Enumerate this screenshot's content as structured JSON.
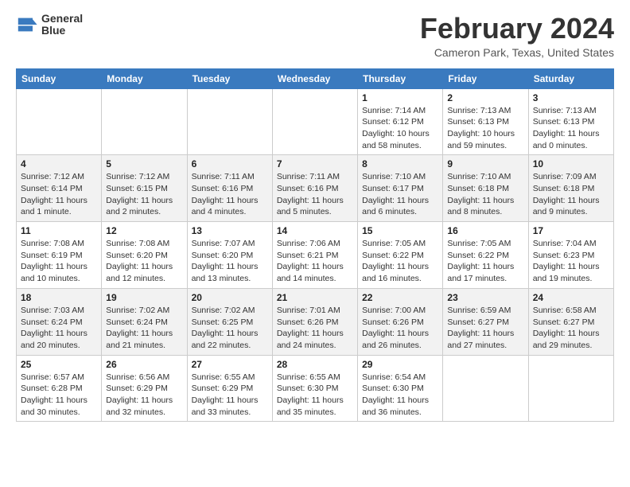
{
  "header": {
    "logo_line1": "General",
    "logo_line2": "Blue",
    "month_title": "February 2024",
    "location": "Cameron Park, Texas, United States"
  },
  "weekdays": [
    "Sunday",
    "Monday",
    "Tuesday",
    "Wednesday",
    "Thursday",
    "Friday",
    "Saturday"
  ],
  "weeks": [
    [
      {
        "day": "",
        "info": ""
      },
      {
        "day": "",
        "info": ""
      },
      {
        "day": "",
        "info": ""
      },
      {
        "day": "",
        "info": ""
      },
      {
        "day": "1",
        "info": "Sunrise: 7:14 AM\nSunset: 6:12 PM\nDaylight: 10 hours\nand 58 minutes."
      },
      {
        "day": "2",
        "info": "Sunrise: 7:13 AM\nSunset: 6:13 PM\nDaylight: 10 hours\nand 59 minutes."
      },
      {
        "day": "3",
        "info": "Sunrise: 7:13 AM\nSunset: 6:13 PM\nDaylight: 11 hours\nand 0 minutes."
      }
    ],
    [
      {
        "day": "4",
        "info": "Sunrise: 7:12 AM\nSunset: 6:14 PM\nDaylight: 11 hours\nand 1 minute."
      },
      {
        "day": "5",
        "info": "Sunrise: 7:12 AM\nSunset: 6:15 PM\nDaylight: 11 hours\nand 2 minutes."
      },
      {
        "day": "6",
        "info": "Sunrise: 7:11 AM\nSunset: 6:16 PM\nDaylight: 11 hours\nand 4 minutes."
      },
      {
        "day": "7",
        "info": "Sunrise: 7:11 AM\nSunset: 6:16 PM\nDaylight: 11 hours\nand 5 minutes."
      },
      {
        "day": "8",
        "info": "Sunrise: 7:10 AM\nSunset: 6:17 PM\nDaylight: 11 hours\nand 6 minutes."
      },
      {
        "day": "9",
        "info": "Sunrise: 7:10 AM\nSunset: 6:18 PM\nDaylight: 11 hours\nand 8 minutes."
      },
      {
        "day": "10",
        "info": "Sunrise: 7:09 AM\nSunset: 6:18 PM\nDaylight: 11 hours\nand 9 minutes."
      }
    ],
    [
      {
        "day": "11",
        "info": "Sunrise: 7:08 AM\nSunset: 6:19 PM\nDaylight: 11 hours\nand 10 minutes."
      },
      {
        "day": "12",
        "info": "Sunrise: 7:08 AM\nSunset: 6:20 PM\nDaylight: 11 hours\nand 12 minutes."
      },
      {
        "day": "13",
        "info": "Sunrise: 7:07 AM\nSunset: 6:20 PM\nDaylight: 11 hours\nand 13 minutes."
      },
      {
        "day": "14",
        "info": "Sunrise: 7:06 AM\nSunset: 6:21 PM\nDaylight: 11 hours\nand 14 minutes."
      },
      {
        "day": "15",
        "info": "Sunrise: 7:05 AM\nSunset: 6:22 PM\nDaylight: 11 hours\nand 16 minutes."
      },
      {
        "day": "16",
        "info": "Sunrise: 7:05 AM\nSunset: 6:22 PM\nDaylight: 11 hours\nand 17 minutes."
      },
      {
        "day": "17",
        "info": "Sunrise: 7:04 AM\nSunset: 6:23 PM\nDaylight: 11 hours\nand 19 minutes."
      }
    ],
    [
      {
        "day": "18",
        "info": "Sunrise: 7:03 AM\nSunset: 6:24 PM\nDaylight: 11 hours\nand 20 minutes."
      },
      {
        "day": "19",
        "info": "Sunrise: 7:02 AM\nSunset: 6:24 PM\nDaylight: 11 hours\nand 21 minutes."
      },
      {
        "day": "20",
        "info": "Sunrise: 7:02 AM\nSunset: 6:25 PM\nDaylight: 11 hours\nand 22 minutes."
      },
      {
        "day": "21",
        "info": "Sunrise: 7:01 AM\nSunset: 6:26 PM\nDaylight: 11 hours\nand 24 minutes."
      },
      {
        "day": "22",
        "info": "Sunrise: 7:00 AM\nSunset: 6:26 PM\nDaylight: 11 hours\nand 26 minutes."
      },
      {
        "day": "23",
        "info": "Sunrise: 6:59 AM\nSunset: 6:27 PM\nDaylight: 11 hours\nand 27 minutes."
      },
      {
        "day": "24",
        "info": "Sunrise: 6:58 AM\nSunset: 6:27 PM\nDaylight: 11 hours\nand 29 minutes."
      }
    ],
    [
      {
        "day": "25",
        "info": "Sunrise: 6:57 AM\nSunset: 6:28 PM\nDaylight: 11 hours\nand 30 minutes."
      },
      {
        "day": "26",
        "info": "Sunrise: 6:56 AM\nSunset: 6:29 PM\nDaylight: 11 hours\nand 32 minutes."
      },
      {
        "day": "27",
        "info": "Sunrise: 6:55 AM\nSunset: 6:29 PM\nDaylight: 11 hours\nand 33 minutes."
      },
      {
        "day": "28",
        "info": "Sunrise: 6:55 AM\nSunset: 6:30 PM\nDaylight: 11 hours\nand 35 minutes."
      },
      {
        "day": "29",
        "info": "Sunrise: 6:54 AM\nSunset: 6:30 PM\nDaylight: 11 hours\nand 36 minutes."
      },
      {
        "day": "",
        "info": ""
      },
      {
        "day": "",
        "info": ""
      }
    ]
  ]
}
